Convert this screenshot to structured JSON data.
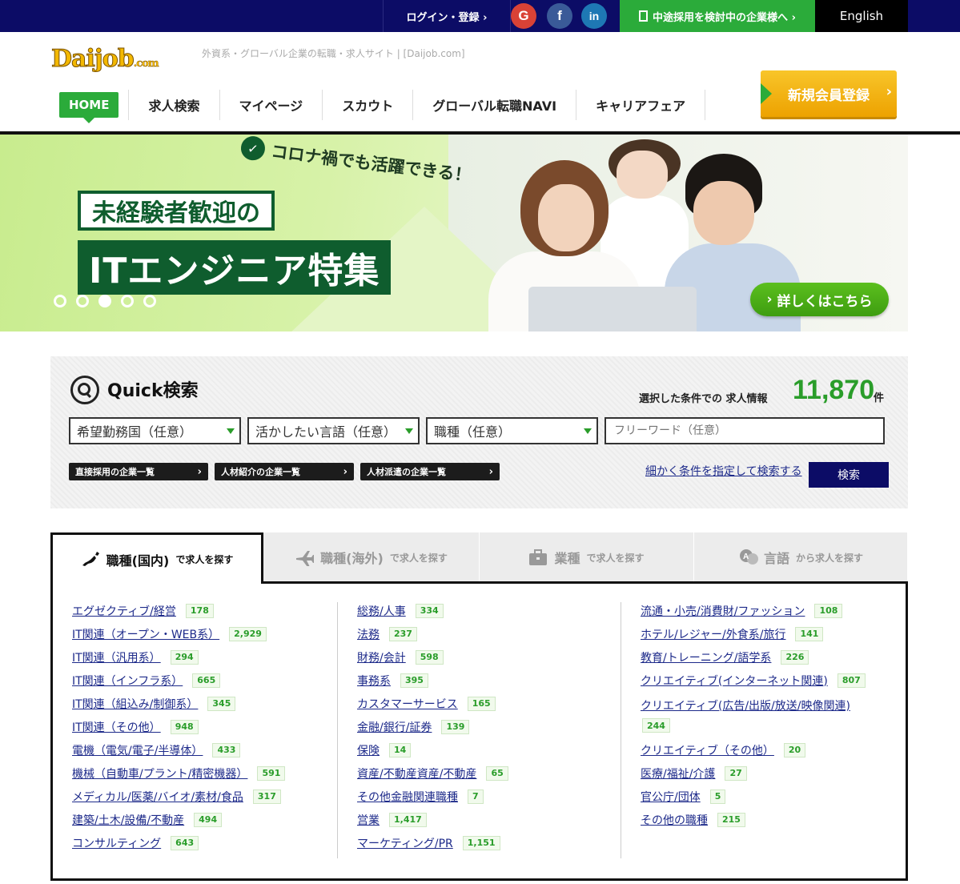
{
  "topbar": {
    "login_label": "ログイン・登録 ›",
    "social": [
      "G",
      "f",
      "in"
    ],
    "business_label": "中途採用を検討中の企業様へ ›",
    "english_label": "English"
  },
  "header": {
    "logo_main": "Daijob",
    "logo_suffix": ".com",
    "tagline": "外資系・グローバル企業の転職・求人サイト | [Daijob.com]",
    "nav": [
      "HOME",
      "求人検索",
      "マイページ",
      "スカウト",
      "グローバル転職NAVI",
      "キャリアフェア"
    ],
    "register_label": "新規会員登録"
  },
  "banner": {
    "sub": "コロナ禍でも活躍できる！",
    "line1": "未経験者歓迎の",
    "line2": "ITエンジニア特集",
    "cta": "詳しくはこちら",
    "active_slide": 3,
    "slide_count": 5
  },
  "quick_search": {
    "title": "Quick検索",
    "count_label": "選択した条件での 求人情報",
    "count": "11,870",
    "count_unit": "件",
    "selects": [
      "希望勤務国（任意）",
      "活かしたい言語（任意）",
      "職種（任意）"
    ],
    "freeword_placeholder": "フリーワード（任意）",
    "pills": [
      "直接採用の企業一覧",
      "人材紹介の企業一覧",
      "人材派遣の企業一覧"
    ],
    "detail_link": "細かく条件を指定して検索する",
    "search_button": "検索"
  },
  "tabs": [
    {
      "main": "職種(国内)",
      "sub": "で求人を探す"
    },
    {
      "main": "職種(海外)",
      "sub": "で求人を探す"
    },
    {
      "main": "業種",
      "sub": "で求人を探す"
    },
    {
      "main": "言語",
      "sub": "から求人を探す"
    }
  ],
  "categories": {
    "col1": [
      {
        "label": "エグゼクティブ/経営",
        "count": "178"
      },
      {
        "label": "IT関連（オープン・WEB系）",
        "count": "2,929"
      },
      {
        "label": "IT関連（汎用系）",
        "count": "294"
      },
      {
        "label": "IT関連（インフラ系）",
        "count": "665"
      },
      {
        "label": "IT関連（組込み/制御系）",
        "count": "345"
      },
      {
        "label": "IT関連（その他）",
        "count": "948"
      },
      {
        "label": "電機（電気/電子/半導体）",
        "count": "433"
      },
      {
        "label": "機械（自動車/プラント/精密機器）",
        "count": "591"
      },
      {
        "label": "メディカル/医薬/バイオ/素材/食品",
        "count": "317"
      },
      {
        "label": "建築/土木/設備/不動産",
        "count": "494"
      },
      {
        "label": "コンサルティング",
        "count": "643"
      }
    ],
    "col2": [
      {
        "label": "総務/人事",
        "count": "334"
      },
      {
        "label": "法務",
        "count": "237"
      },
      {
        "label": "財務/会計",
        "count": "598"
      },
      {
        "label": "事務系",
        "count": "395"
      },
      {
        "label": "カスタマーサービス",
        "count": "165"
      },
      {
        "label": "金融/銀行/証券",
        "count": "139"
      },
      {
        "label": "保険",
        "count": "14"
      },
      {
        "label": "資産/不動産資産/不動産",
        "count": "65"
      },
      {
        "label": "その他金融関連職種",
        "count": "7"
      },
      {
        "label": "営業",
        "count": "1,417"
      },
      {
        "label": "マーケティング/PR",
        "count": "1,151"
      }
    ],
    "col3": [
      {
        "label": "流通・小売/消費財/ファッション",
        "count": "108"
      },
      {
        "label": "ホテル/レジャー/外食系/旅行",
        "count": "141"
      },
      {
        "label": "教育/トレーニング/語学系",
        "count": "226"
      },
      {
        "label": "クリエイティブ(インターネット関連)",
        "count": "807"
      },
      {
        "label": "クリエイティブ(広告/出版/放送/映像関連)",
        "count": "244"
      },
      {
        "label": "クリエイティブ（その他）",
        "count": "20"
      },
      {
        "label": "医療/福祉/介護",
        "count": "27"
      },
      {
        "label": "官公庁/団体",
        "count": "5"
      },
      {
        "label": "その他の職種",
        "count": "215"
      }
    ]
  },
  "colors": {
    "navy": "#0c0c66",
    "green": "#2bab3a",
    "dark_green": "#0f5d2e",
    "orange": "#f3b800"
  }
}
